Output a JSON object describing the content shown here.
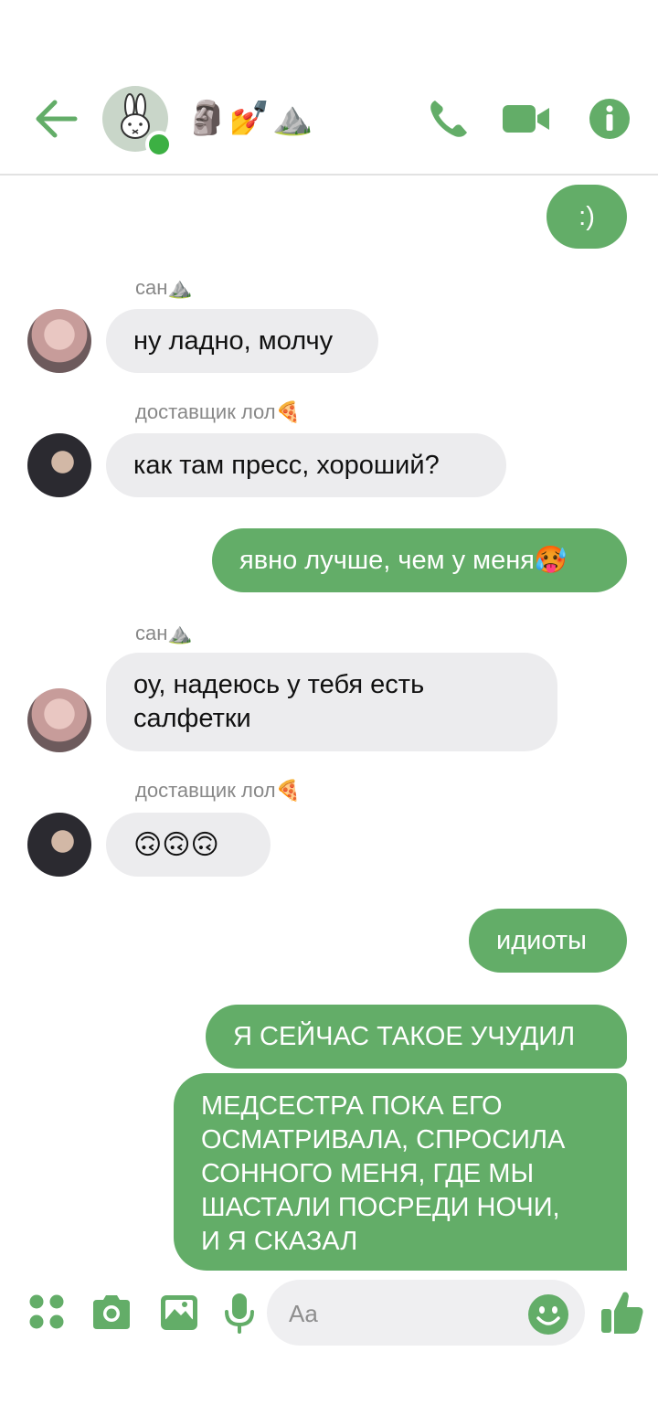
{
  "header": {
    "title": "🗿💅⛰️",
    "icons": [
      "back-arrow-icon",
      "phone-icon",
      "video-camera-icon",
      "info-icon"
    ],
    "accent": "#63ad68",
    "online_color": "#3cb043"
  },
  "messages": [
    {
      "type": "outgoing",
      "text": ":)"
    },
    {
      "type": "incoming",
      "sender": "сан⛰️",
      "text": "ну ладно, молчу"
    },
    {
      "type": "incoming",
      "sender": "доставщик лол🍕",
      "text": "как там пресс, хороший?"
    },
    {
      "type": "outgoing",
      "text": "явно лучше, чем у меня🥵"
    },
    {
      "type": "incoming",
      "sender": "сан⛰️",
      "line1": "оу, надеюсь у тебя есть",
      "line2": "салфетки"
    },
    {
      "type": "incoming",
      "sender": "доставщик лол🍕",
      "text": "🙃🙃🙃"
    },
    {
      "type": "outgoing",
      "text": "идиоты"
    },
    {
      "type": "outgoing",
      "text": "Я СЕЙЧАС ТАКОЕ УЧУДИЛ"
    },
    {
      "type": "outgoing",
      "line1": "МЕДСЕСТРА ПОКА ЕГО",
      "line2": "ОСМАТРИВАЛА, СПРОСИЛА",
      "line3": "СОННОГО МЕНЯ, ГДЕ МЫ",
      "line4": "ШАСТАЛИ ПОСРЕДИ НОЧИ,",
      "line5": "И Я СКАЗАЛ"
    }
  ],
  "composer": {
    "placeholder": "Aa",
    "icons": [
      "apps-grid-icon",
      "camera-icon",
      "gallery-icon",
      "microphone-icon",
      "emoji-icon",
      "thumbs-up-icon"
    ]
  }
}
